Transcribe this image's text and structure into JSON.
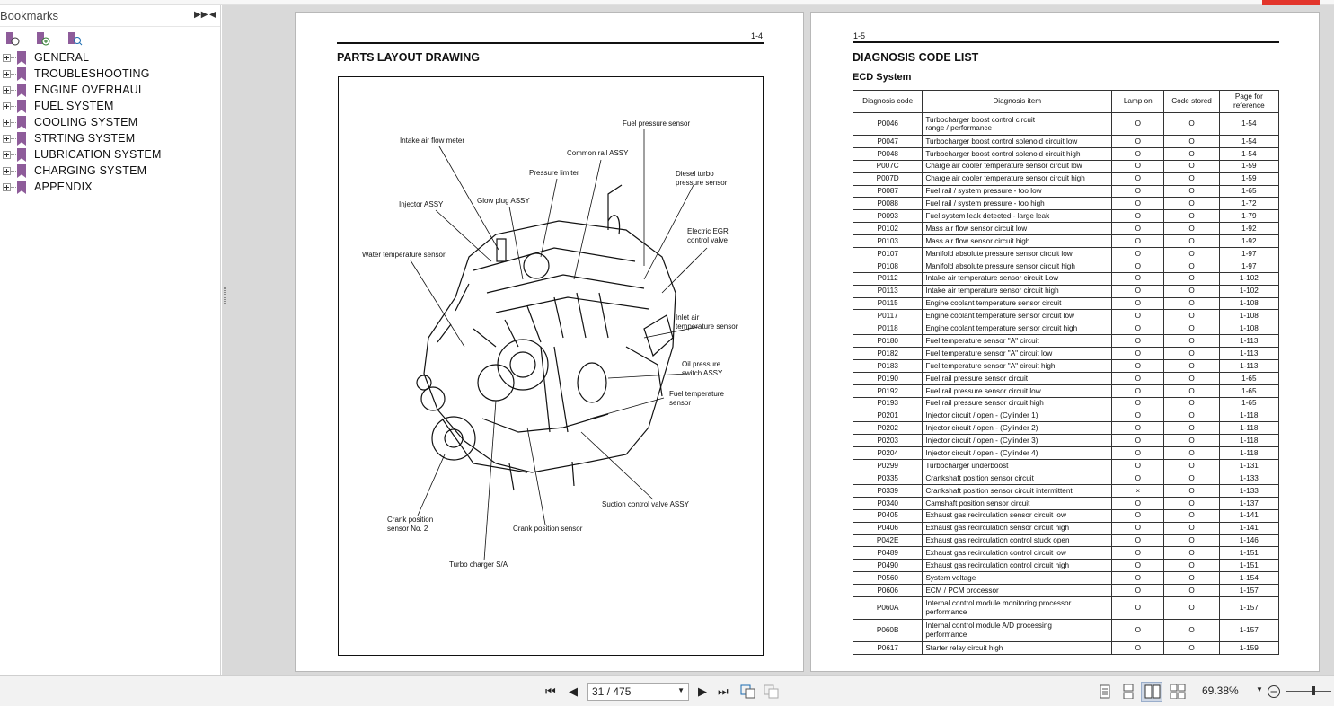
{
  "sidebar": {
    "title": "Bookmarks",
    "items": [
      {
        "label": "GENERAL"
      },
      {
        "label": "TROUBLESHOOTING"
      },
      {
        "label": "ENGINE OVERHAUL"
      },
      {
        "label": "FUEL SYSTEM"
      },
      {
        "label": "COOLING SYSTEM"
      },
      {
        "label": "STRTING SYSTEM"
      },
      {
        "label": "LUBRICATION SYSTEM"
      },
      {
        "label": "CHARGING SYSTEM"
      },
      {
        "label": "APPENDIX"
      }
    ]
  },
  "page_left": {
    "number": "1-4",
    "title": "PARTS LAYOUT DRAWING",
    "callouts": [
      "Fuel pressure sensor",
      "Intake air flow meter",
      "Common rail ASSY",
      "Pressure limiter",
      "Diesel turbo\npressure sensor",
      "Injector ASSY",
      "Glow plug ASSY",
      "Electric EGR\ncontrol valve",
      "Water temperature sensor",
      "Inlet air\ntemperature sensor",
      "Oil pressure\nswitch ASSY",
      "Fuel temperature\nsensor",
      "Suction control valve ASSY",
      "Crank position\nsensor No. 2",
      "Crank position sensor",
      "Turbo charger S/A"
    ]
  },
  "page_right": {
    "number": "1-5",
    "title": "DIAGNOSIS CODE LIST",
    "subtitle": "ECD System",
    "headers": [
      "Diagnosis code",
      "Diagnosis item",
      "Lamp on",
      "Code stored",
      "Page for\nreference"
    ],
    "rows": [
      [
        "P0046",
        "Turbocharger boost control circuit\nrange / performance",
        "O",
        "O",
        "1-54"
      ],
      [
        "P0047",
        "Turbocharger boost control solenoid circuit low",
        "O",
        "O",
        "1-54"
      ],
      [
        "P0048",
        "Turbocharger boost control solenoid circuit high",
        "O",
        "O",
        "1-54"
      ],
      [
        "P007C",
        "Charge air cooler temperature sensor circuit low",
        "O",
        "O",
        "1-59"
      ],
      [
        "P007D",
        "Charge air cooler temperature sensor circuit high",
        "O",
        "O",
        "1-59"
      ],
      [
        "P0087",
        "Fuel rail / system pressure - too low",
        "O",
        "O",
        "1-65"
      ],
      [
        "P0088",
        "Fuel rail / system pressure - too high",
        "O",
        "O",
        "1-72"
      ],
      [
        "P0093",
        "Fuel system leak detected - large leak",
        "O",
        "O",
        "1-79"
      ],
      [
        "P0102",
        "Mass air flow sensor circuit low",
        "O",
        "O",
        "1-92"
      ],
      [
        "P0103",
        "Mass air flow sensor circuit high",
        "O",
        "O",
        "1-92"
      ],
      [
        "P0107",
        "Manifold absolute pressure sensor circuit low",
        "O",
        "O",
        "1-97"
      ],
      [
        "P0108",
        "Manifold absolute pressure sensor circuit high",
        "O",
        "O",
        "1-97"
      ],
      [
        "P0112",
        "Intake air temperature sensor circuit Low",
        "O",
        "O",
        "1-102"
      ],
      [
        "P0113",
        "Intake air temperature sensor circuit high",
        "O",
        "O",
        "1-102"
      ],
      [
        "P0115",
        "Engine coolant temperature sensor circuit",
        "O",
        "O",
        "1-108"
      ],
      [
        "P0117",
        "Engine coolant temperature sensor circuit low",
        "O",
        "O",
        "1-108"
      ],
      [
        "P0118",
        "Engine coolant temperature sensor circuit high",
        "O",
        "O",
        "1-108"
      ],
      [
        "P0180",
        "Fuel temperature sensor \"A\" circuit",
        "O",
        "O",
        "1-113"
      ],
      [
        "P0182",
        "Fuel temperature sensor \"A\" circuit low",
        "O",
        "O",
        "1-113"
      ],
      [
        "P0183",
        "Fuel temperature sensor \"A\" circuit high",
        "O",
        "O",
        "1-113"
      ],
      [
        "P0190",
        "Fuel rail pressure sensor circuit",
        "O",
        "O",
        "1-65"
      ],
      [
        "P0192",
        "Fuel rail pressure sensor circuit low",
        "O",
        "O",
        "1-65"
      ],
      [
        "P0193",
        "Fuel rail pressure sensor circuit high",
        "O",
        "O",
        "1-65"
      ],
      [
        "P0201",
        "Injector circuit / open - (Cylinder 1)",
        "O",
        "O",
        "1-118"
      ],
      [
        "P0202",
        "Injector circuit / open - (Cylinder 2)",
        "O",
        "O",
        "1-118"
      ],
      [
        "P0203",
        "Injector circuit / open - (Cylinder 3)",
        "O",
        "O",
        "1-118"
      ],
      [
        "P0204",
        "Injector circuit / open - (Cylinder 4)",
        "O",
        "O",
        "1-118"
      ],
      [
        "P0299",
        "Turbocharger underboost",
        "O",
        "O",
        "1-131"
      ],
      [
        "P0335",
        "Crankshaft position sensor circuit",
        "O",
        "O",
        "1-133"
      ],
      [
        "P0339",
        "Crankshaft position sensor circuit intermittent",
        "×",
        "O",
        "1-133"
      ],
      [
        "P0340",
        "Camshaft position sensor circuit",
        "O",
        "O",
        "1-137"
      ],
      [
        "P0405",
        "Exhaust gas recirculation sensor circuit low",
        "O",
        "O",
        "1-141"
      ],
      [
        "P0406",
        "Exhaust gas recirculation sensor circuit high",
        "O",
        "O",
        "1-141"
      ],
      [
        "P042E",
        "Exhaust gas recirculation control stuck open",
        "O",
        "O",
        "1-146"
      ],
      [
        "P0489",
        "Exhaust gas recirculation control circuit low",
        "O",
        "O",
        "1-151"
      ],
      [
        "P0490",
        "Exhaust gas recirculation control circuit high",
        "O",
        "O",
        "1-151"
      ],
      [
        "P0560",
        "System voltage",
        "O",
        "O",
        "1-154"
      ],
      [
        "P0606",
        "ECM / PCM processor",
        "O",
        "O",
        "1-157"
      ],
      [
        "P060A",
        "Internal control module monitoring processor\nperformance",
        "O",
        "O",
        "1-157"
      ],
      [
        "P060B",
        "Internal control module A/D processing\nperformance",
        "O",
        "O",
        "1-157"
      ],
      [
        "P0617",
        "Starter relay circuit high",
        "O",
        "O",
        "1-159"
      ]
    ]
  },
  "toolbar": {
    "page_indicator": "31 / 475",
    "zoom": "69.38%"
  },
  "colors": {
    "bookmark_flag": "#8e5c9a",
    "viewer_bg": "#d9d9d9",
    "accent": "#e2352b"
  }
}
